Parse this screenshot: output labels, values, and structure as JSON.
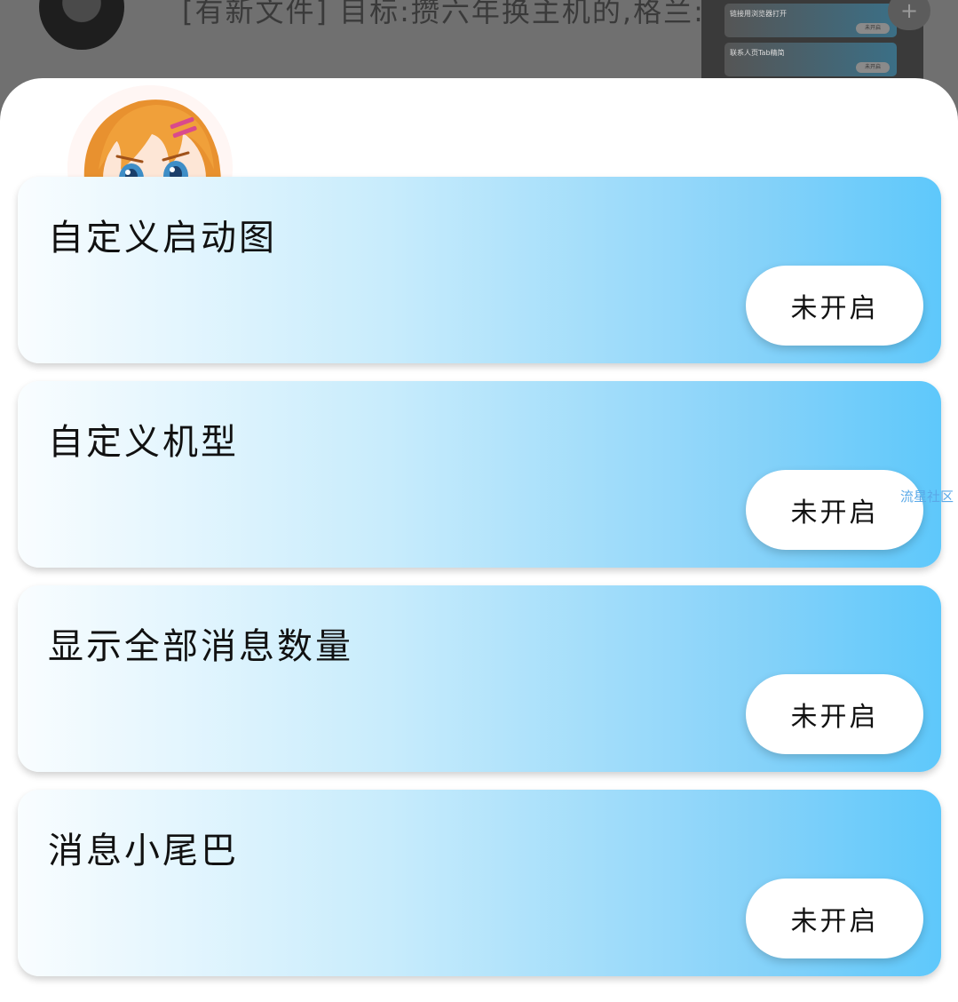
{
  "background": {
    "title": "[有新文件] 目标:攒六年换主机的,格兰: 分",
    "panel_items": [
      {
        "label": "链接用浏览器打开",
        "button": "未开启"
      },
      {
        "label": "联系人页Tab精简",
        "button": "未开启"
      }
    ],
    "plus": "+"
  },
  "side_label": "流星社区",
  "settings": [
    {
      "title": "自定义启动图",
      "toggle": "未开启"
    },
    {
      "title": "自定义机型",
      "toggle": "未开启"
    },
    {
      "title": "显示全部消息数量",
      "toggle": "未开启"
    },
    {
      "title": "消息小尾巴",
      "toggle": "未开启"
    }
  ],
  "colors": {
    "card_gradient_start": "#f9fdff",
    "card_gradient_end": "#5ec8fb",
    "accent_text": "#5aa9e8"
  }
}
